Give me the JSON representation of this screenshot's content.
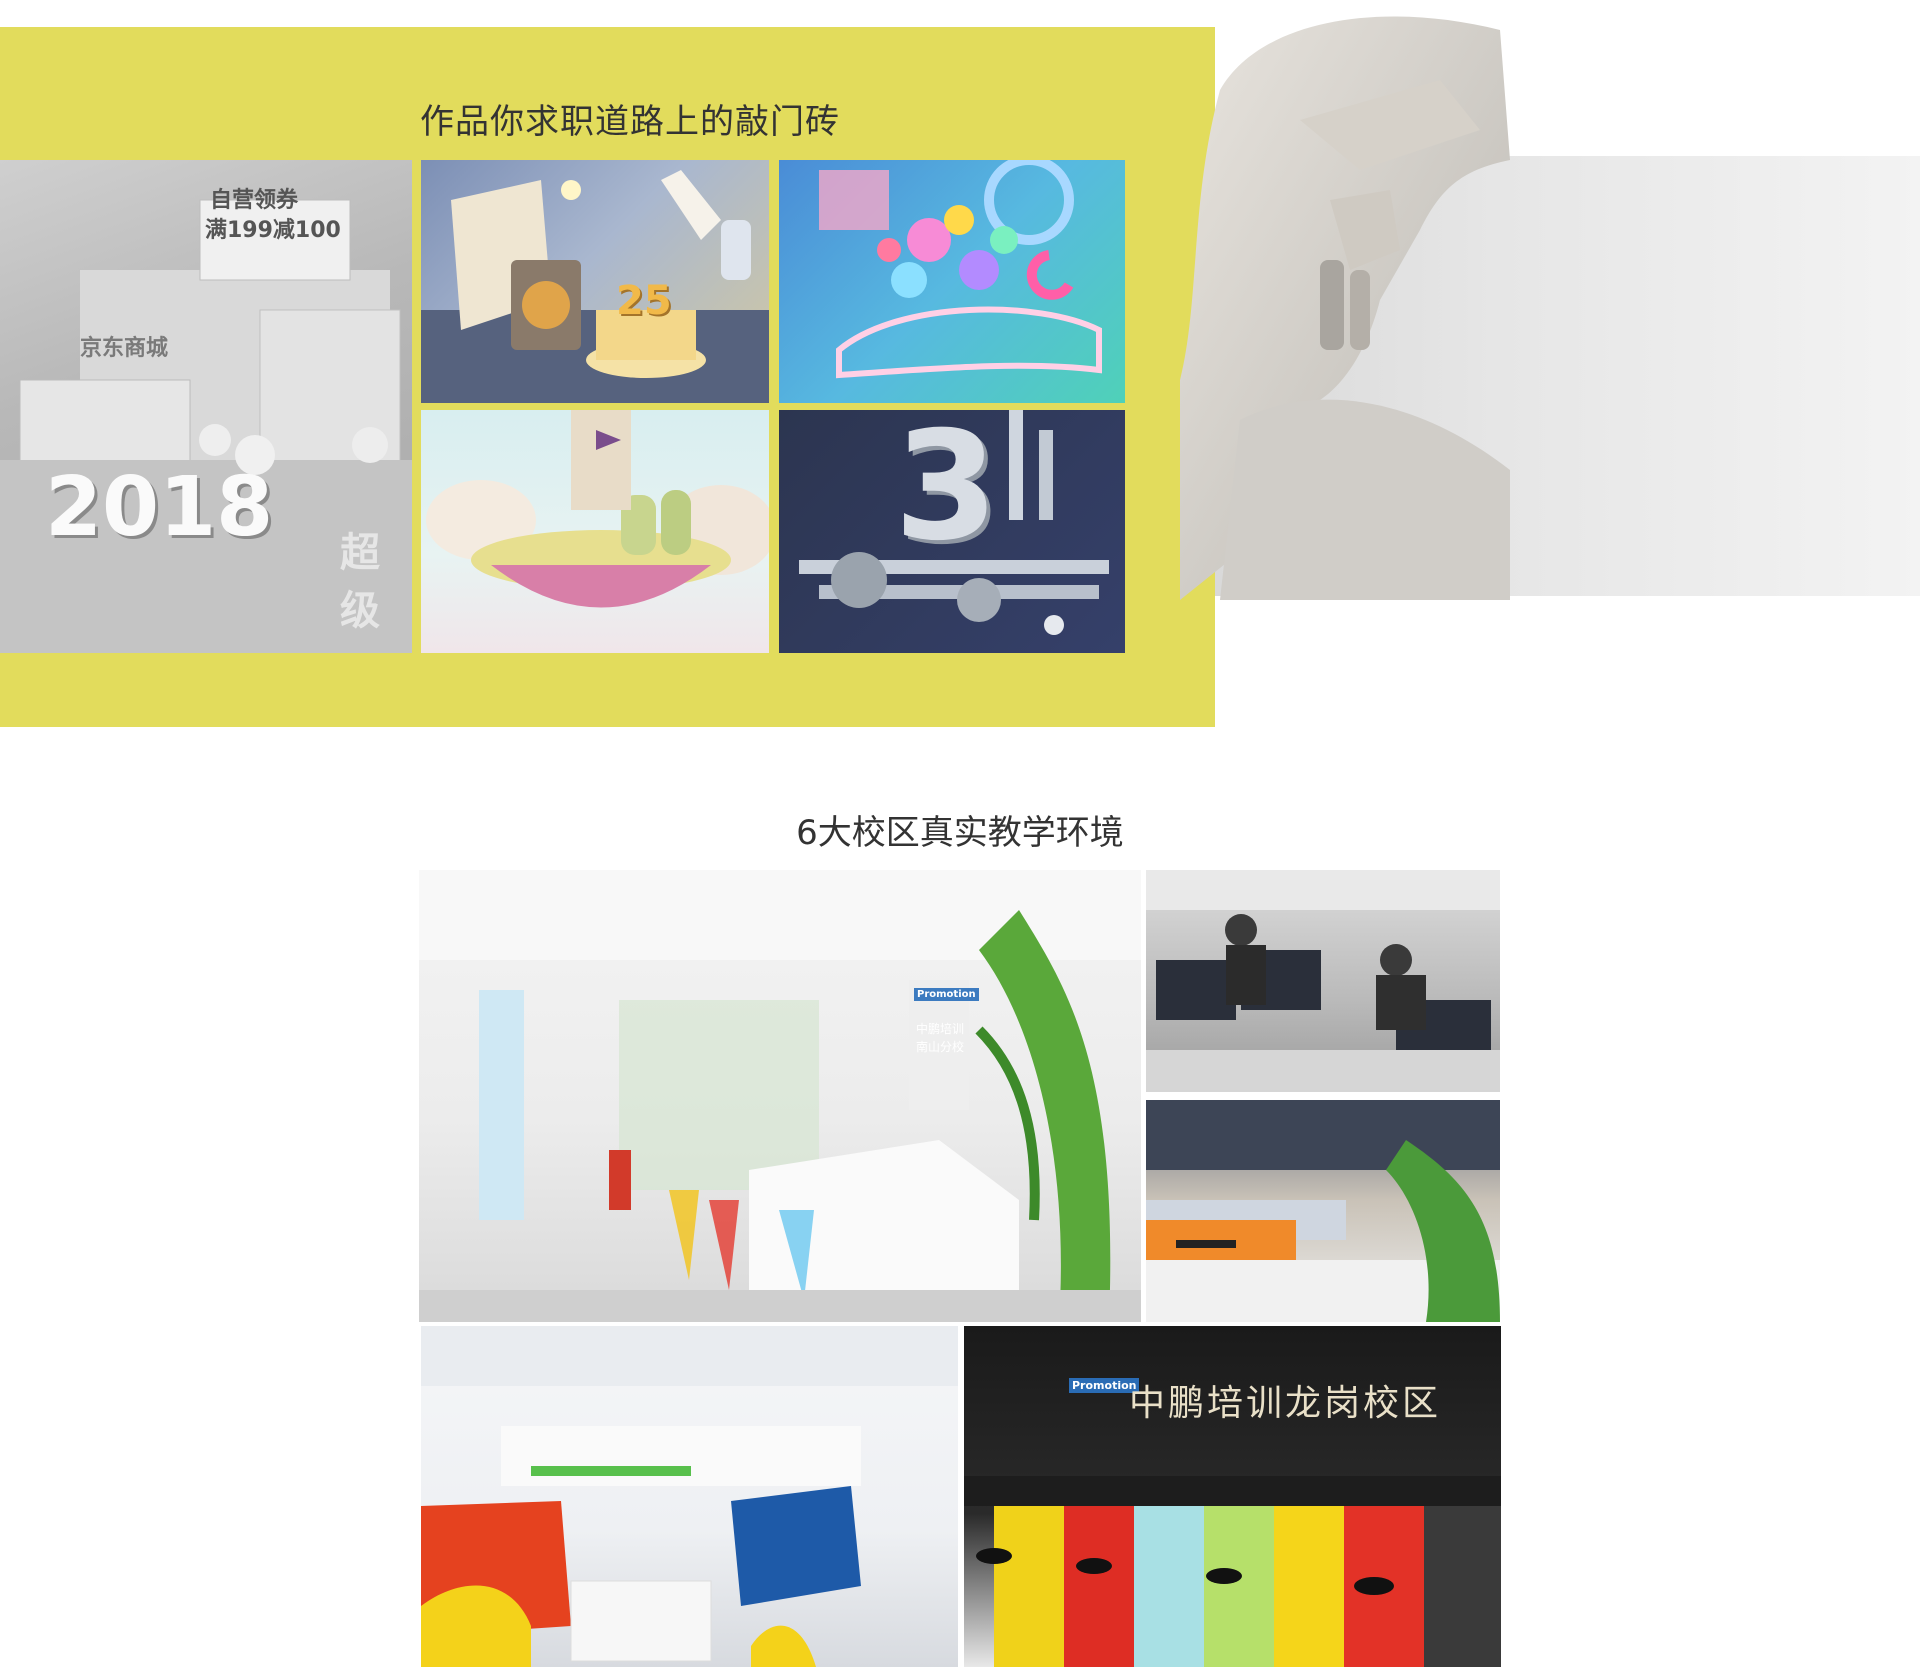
{
  "portfolio": {
    "heading": "作品你求职道路上的敲门砖",
    "tiles": {
      "jd": {
        "lines": [
          "自营领券",
          "满199减100",
          "京东商城",
          "2018",
          "超级"
        ]
      },
      "cake": {
        "number": "25"
      },
      "three": {
        "number": "3"
      }
    }
  },
  "campus": {
    "heading": "6大校区真实教学环境",
    "photos": {
      "reception": {
        "brand": "Promotion",
        "sign_line1": "中鹏培训",
        "sign_line2": "南山分校"
      },
      "longgang": {
        "brand": "Promotion",
        "sign": "中鹏培训龙岗校区"
      }
    }
  },
  "colors": {
    "accent_yellow": "#e2dc5c",
    "gray_band": "#e2e2e2"
  }
}
